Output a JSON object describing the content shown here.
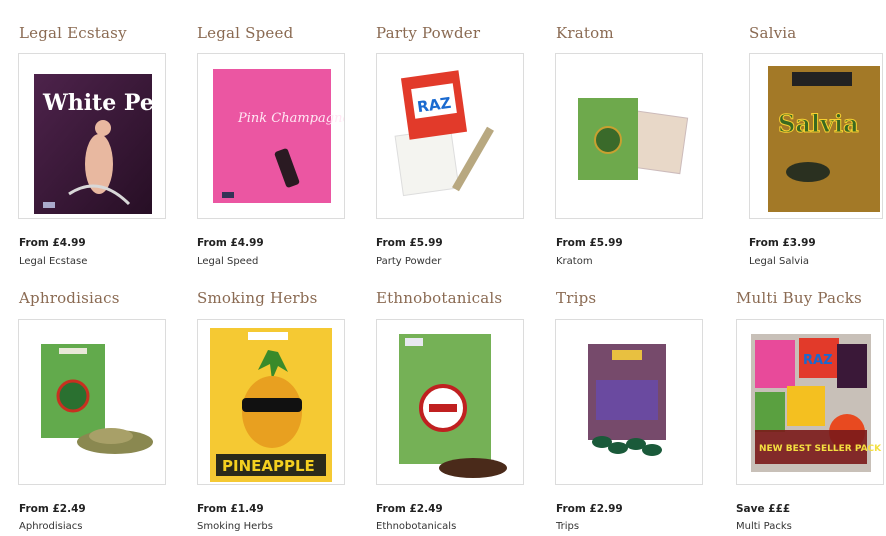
{
  "categories": [
    {
      "title": "Legal Ecstasy",
      "price": "From £4.99",
      "name": "Legal Ecstase",
      "art": "White Pearls"
    },
    {
      "title": "Legal Speed",
      "price": "From £4.99",
      "name": "Legal Speed",
      "art": "Pink Champagne"
    },
    {
      "title": "Party Powder",
      "price": "From £5.99",
      "name": "Party Powder",
      "art": "RAZ"
    },
    {
      "title": "Kratom",
      "price": "From £5.99",
      "name": "Kratom"
    },
    {
      "title": "Salvia",
      "price": "From £3.99",
      "name": "Legal Salvia",
      "art": "Salvia"
    },
    {
      "title": "Aphrodisiacs",
      "price": "From £2.49",
      "name": "Aphrodisiacs"
    },
    {
      "title": "Smoking Herbs",
      "price": "From £1.49",
      "name": "Smoking Herbs",
      "art": "PINEAPPLE"
    },
    {
      "title": "Ethnobotanicals",
      "price": "From £2.49",
      "name": "Ethnobotanicals"
    },
    {
      "title": "Trips",
      "price": "From £2.99",
      "name": "Trips"
    },
    {
      "title": "Multi Buy Packs",
      "price": "Save £££",
      "name": "Multi Packs",
      "art": "RAZ",
      "art2": "NEW BEST SELLER PACK"
    }
  ]
}
